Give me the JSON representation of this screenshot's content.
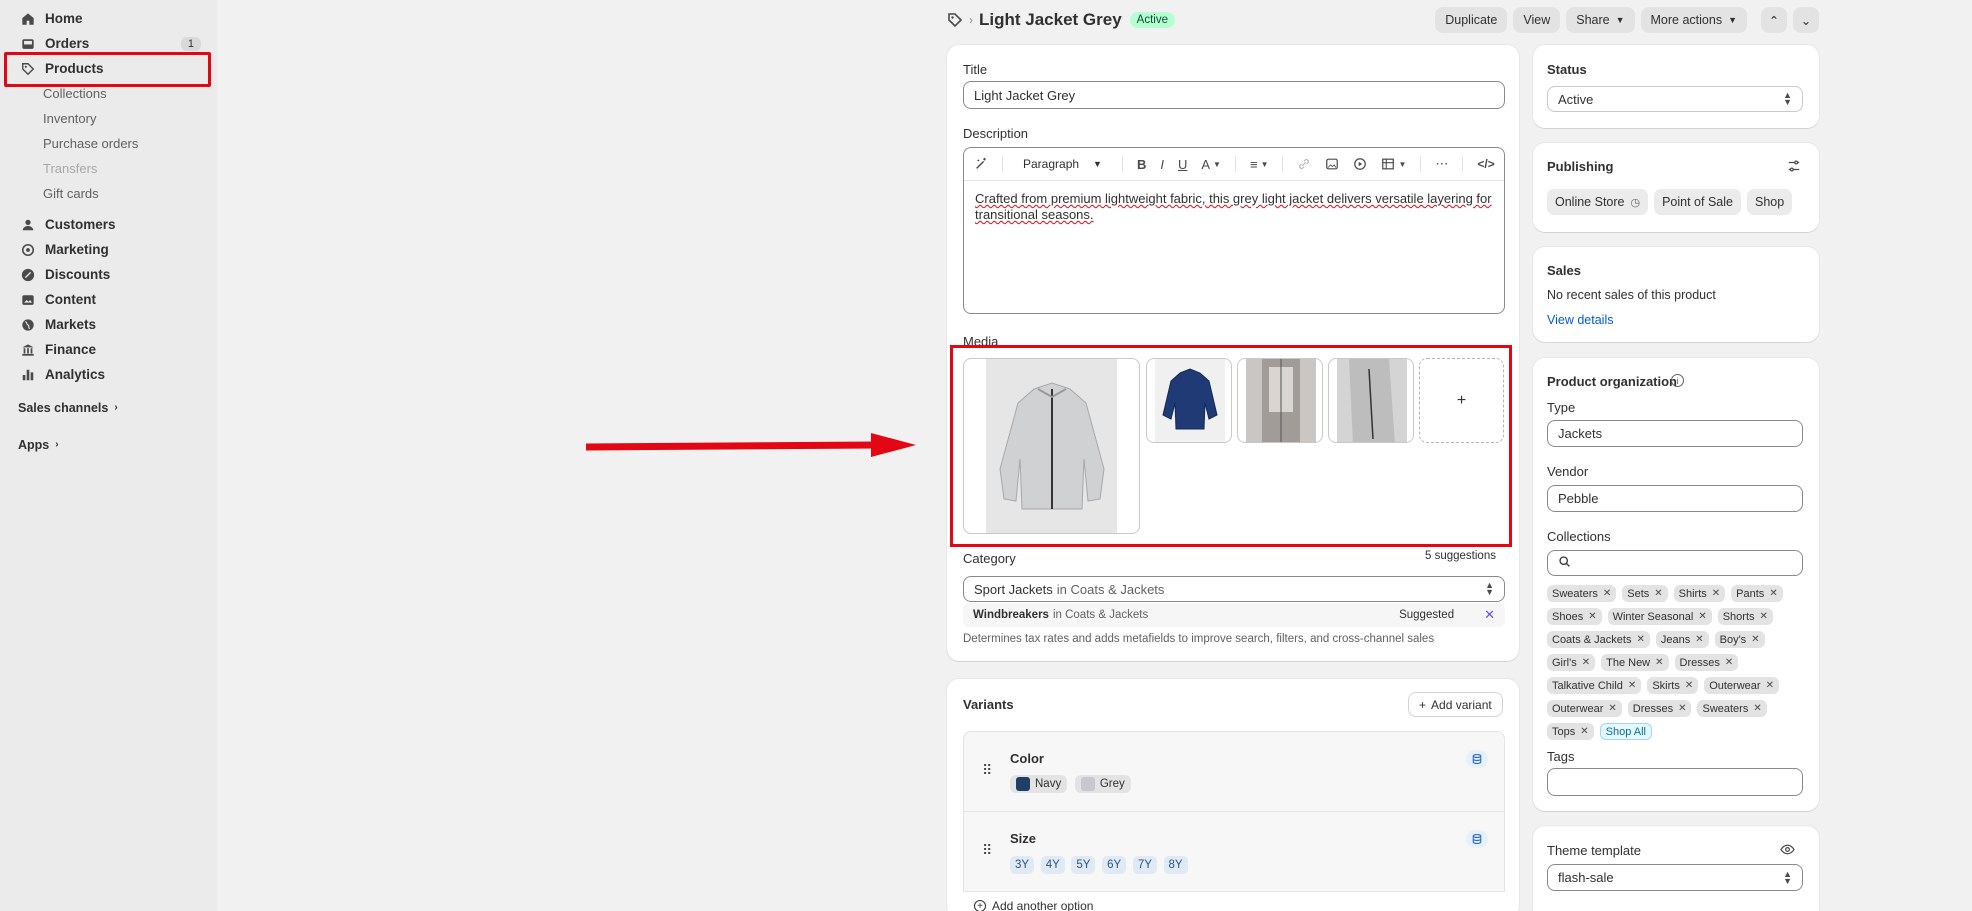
{
  "sidebar": {
    "home": "Home",
    "orders": "Orders",
    "orders_badge": "1",
    "products": "Products",
    "collections": "Collections",
    "inventory": "Inventory",
    "purchase_orders": "Purchase orders",
    "transfers": "Transfers",
    "gift_cards": "Gift cards",
    "customers": "Customers",
    "marketing": "Marketing",
    "discounts": "Discounts",
    "content": "Content",
    "markets": "Markets",
    "finance": "Finance",
    "analytics": "Analytics",
    "sales_channels": "Sales channels",
    "apps": "Apps"
  },
  "header": {
    "title": "Light Jacket Grey",
    "status_pill": "Active",
    "duplicate": "Duplicate",
    "view": "View",
    "share": "Share",
    "more_actions": "More actions"
  },
  "main": {
    "title_label": "Title",
    "title_value": "Light Jacket Grey",
    "description_label": "Description",
    "paragraph": "Paragraph",
    "description_text": "Crafted from premium lightweight fabric, this grey light jacket delivers versatile layering for transitional seasons.",
    "media_label": "Media",
    "add_media": "+",
    "category_label": "Category",
    "suggestions": "5 suggestions",
    "category_value": "Sport Jackets",
    "category_in": "in Coats & Jackets",
    "suggest_name": "Windbreakers",
    "suggest_in": "in Coats & Jackets",
    "suggested": "Suggested",
    "category_help": "Determines tax rates and adds metafields to improve search, filters, and cross-channel sales"
  },
  "variants": {
    "title": "Variants",
    "add_variant": "Add variant",
    "color_name": "Color",
    "colors": [
      {
        "label": "Navy",
        "swatch": "#1f3f66"
      },
      {
        "label": "Grey",
        "swatch": "#c7c9cc"
      }
    ],
    "size_name": "Size",
    "sizes": [
      "3Y",
      "4Y",
      "5Y",
      "6Y",
      "7Y",
      "8Y"
    ],
    "add_option": "Add another option"
  },
  "status": {
    "label": "Status",
    "value": "Active"
  },
  "publishing": {
    "title": "Publishing",
    "channels": [
      "Online Store",
      "Point of Sale",
      "Shop"
    ]
  },
  "sales": {
    "title": "Sales",
    "text": "No recent sales of this product",
    "link": "View details"
  },
  "organization": {
    "title": "Product organization",
    "type_label": "Type",
    "type_value": "Jackets",
    "vendor_label": "Vendor",
    "vendor_value": "Pebble",
    "collections_label": "Collections",
    "collections": [
      "Sweaters",
      "Sets",
      "Shirts",
      "Pants",
      "Shoes",
      "Winter Seasonal",
      "Shorts",
      "Coats & Jackets",
      "Jeans",
      "Boy's",
      "Girl's",
      "The New",
      "Dresses",
      "Talkative Child",
      "Skirts",
      "Outerwear",
      "Outerwear",
      "Dresses",
      "Sweaters",
      "Tops"
    ],
    "shop_all": "Shop All",
    "tags_label": "Tags"
  },
  "theme": {
    "label": "Theme template",
    "value": "flash-sale"
  },
  "colors": {
    "highlight": "#e30613",
    "link": "#005bd3",
    "active_pill": "#b4fed2"
  }
}
